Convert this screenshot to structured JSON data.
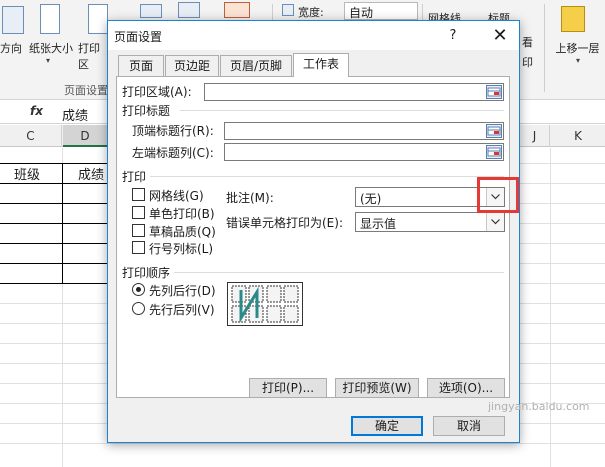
{
  "ribbon": {
    "orientation_label": "方向",
    "paper_size_label": "纸张大小",
    "print_area_label": "打印区",
    "group_page_setup": "页面设置",
    "width_label": "宽度:",
    "width_value": "自动",
    "gridlines_label": "网格线",
    "headings_label": "标题",
    "view_label": "看",
    "print_label": "印",
    "bring_forward_label": "上移一层"
  },
  "formula_bar": {
    "fx": "fx",
    "content": "成绩"
  },
  "columns": [
    "C",
    "D",
    "J",
    "K"
  ],
  "sheet": {
    "cell_class": "班级",
    "cell_score": "成绩"
  },
  "dialog": {
    "title": "页面设置",
    "help": "?",
    "close": "✕",
    "tabs": [
      "页面",
      "页边距",
      "页眉/页脚",
      "工作表"
    ],
    "print_area_label": "打印区域(A):",
    "print_titles_label": "打印标题",
    "rows_to_repeat_label": "顶端标题行(R):",
    "cols_to_repeat_label": "左端标题列(C):",
    "print_section_label": "打印",
    "checkboxes": [
      "网格线(G)",
      "单色打印(B)",
      "草稿品质(Q)",
      "行号列标(L)"
    ],
    "comments_label": "批注(M):",
    "comments_value": "(无)",
    "cell_errors_label": "错误单元格打印为(E):",
    "cell_errors_value": "显示值",
    "page_order_label": "打印顺序",
    "radio_down_then_over": "先列后行(D)",
    "radio_over_then_down": "先行后列(V)",
    "print_button": "打印(P)...",
    "preview_button": "打印预览(W)",
    "options_button": "选项(O)...",
    "ok_button": "确定",
    "cancel_button": "取消"
  },
  "watermark": "jingyan.baidu.com",
  "colors": {
    "accent": "#0078d7",
    "highlight": "#e53935",
    "excel_green": "#217346"
  }
}
